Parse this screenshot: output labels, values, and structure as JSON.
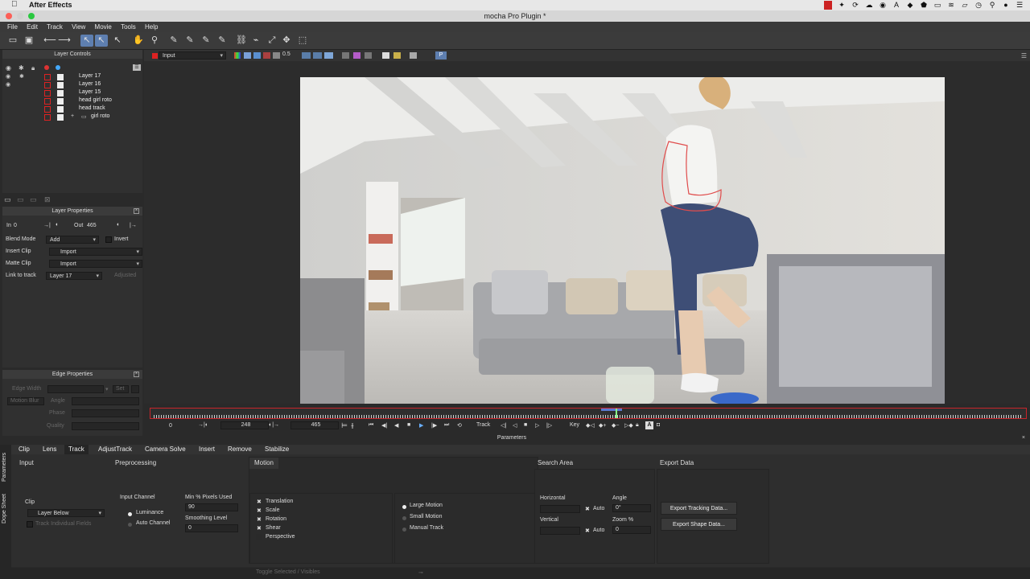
{
  "macbar": {
    "app_name": "After Effects"
  },
  "window": {
    "title": "mocha Pro Plugin *"
  },
  "menu": {
    "items": [
      "File",
      "Edit",
      "Track",
      "View",
      "Movie",
      "Tools",
      "Help"
    ]
  },
  "viewer_bar": {
    "input_label": "Input",
    "opacity": "0.5"
  },
  "layer_controls": {
    "title": "Layer Controls",
    "layers": [
      "Layer 17",
      "Layer 16",
      "Layer 15",
      "head girl roto",
      "head track",
      "girl roto"
    ]
  },
  "layer_properties": {
    "title": "Layer Properties",
    "in_label": "In",
    "in_value": "0",
    "out_label": "Out",
    "out_value": "465",
    "blend_mode_label": "Blend Mode",
    "blend_mode_value": "Add",
    "invert_label": "Invert",
    "insert_clip_label": "Insert Clip",
    "insert_clip_value": "Import",
    "matte_clip_label": "Matte Clip",
    "matte_clip_value": "Import",
    "link_label": "Link to track",
    "link_value": "Layer 17",
    "adjusted_label": "Adjusted"
  },
  "edge_properties": {
    "title": "Edge Properties",
    "edge_width_label": "Edge Width",
    "motion_blur_label": "Motion Blur",
    "angle_label": "Angle",
    "phase_label": "Phase",
    "quality_label": "Quality",
    "set_label": "Set"
  },
  "transport": {
    "start_frame": "0",
    "current_frame": "248",
    "end_frame": "465",
    "track_label": "Track",
    "key_label": "Key"
  },
  "parameters_title": "Parameters",
  "side_tabs": [
    "Parameters",
    "Dope Sheet"
  ],
  "tabs": [
    "Clip",
    "Lens",
    "Track",
    "AdjustTrack",
    "Camera Solve",
    "Insert",
    "Remove",
    "Stabilize"
  ],
  "track_params": {
    "input_label": "Input",
    "preprocessing_label": "Preprocessing",
    "clip_label": "Clip",
    "clip_value": "Layer Below",
    "track_fields_label": "Track Individual Fields",
    "input_channel_label": "Input Channel",
    "luminance_label": "Luminance",
    "auto_channel_label": "Auto Channel",
    "min_pixels_label": "Min % Pixels Used",
    "min_pixels_value": "90",
    "smoothing_label": "Smoothing Level",
    "smoothing_value": "0",
    "motion_label": "Motion",
    "motion_options": [
      "Translation",
      "Scale",
      "Rotation",
      "Shear",
      "Perspective"
    ],
    "large_motion_label": "Large Motion",
    "small_motion_label": "Small Motion",
    "manual_track_label": "Manual Track",
    "search_area_label": "Search Area",
    "horizontal_label": "Horizontal",
    "vertical_label": "Vertical",
    "auto_label": "Auto",
    "angle_label": "Angle",
    "angle_value": "0°",
    "zoom_label": "Zoom %",
    "zoom_value": "0",
    "export_label": "Export Data",
    "export_tracking_label": "Export Tracking Data...",
    "export_shape_label": "Export Shape Data..."
  },
  "status": {
    "hint": "Toggle Selected / Visibles"
  },
  "colors": {
    "accent_red": "#c8242a",
    "select_blue": "#5e7fb0"
  }
}
